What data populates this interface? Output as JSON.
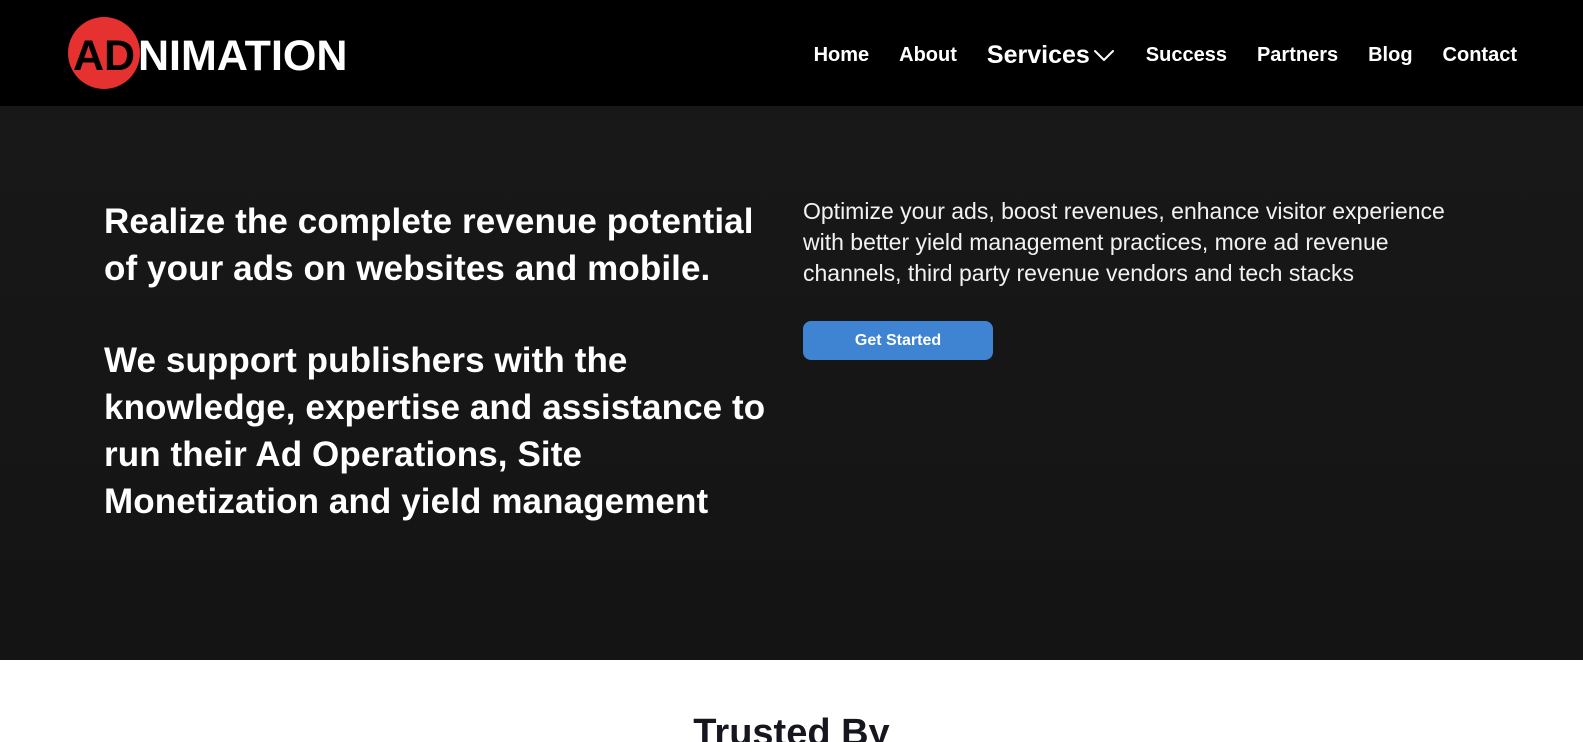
{
  "header": {
    "logo": {
      "circle_text": "AD",
      "wordmark": "NIMATION",
      "circle_color": "#e53130",
      "text_color": "#ffffff"
    },
    "nav": [
      {
        "label": "Home"
      },
      {
        "label": "About"
      },
      {
        "label": "Services",
        "icon": "chevron-down-icon"
      },
      {
        "label": "Success"
      },
      {
        "label": "Partners"
      },
      {
        "label": "Blog"
      },
      {
        "label": "Contact"
      }
    ]
  },
  "hero": {
    "headline_1": "Realize the complete revenue potential of your ads on websites and mobile.",
    "headline_2": "We support publishers with the knowledge, expertise and assistance to run their Ad Operations, Site Monetization and yield management",
    "copy": "Optimize your ads, boost revenues, enhance visitor experience with better yield management practices, more ad revenue channels, third party revenue vendors and tech stacks",
    "cta_label": "Get Started",
    "cta_color": "#3f84d2",
    "background": "#151515"
  },
  "trusted": {
    "title": "Trusted By"
  }
}
